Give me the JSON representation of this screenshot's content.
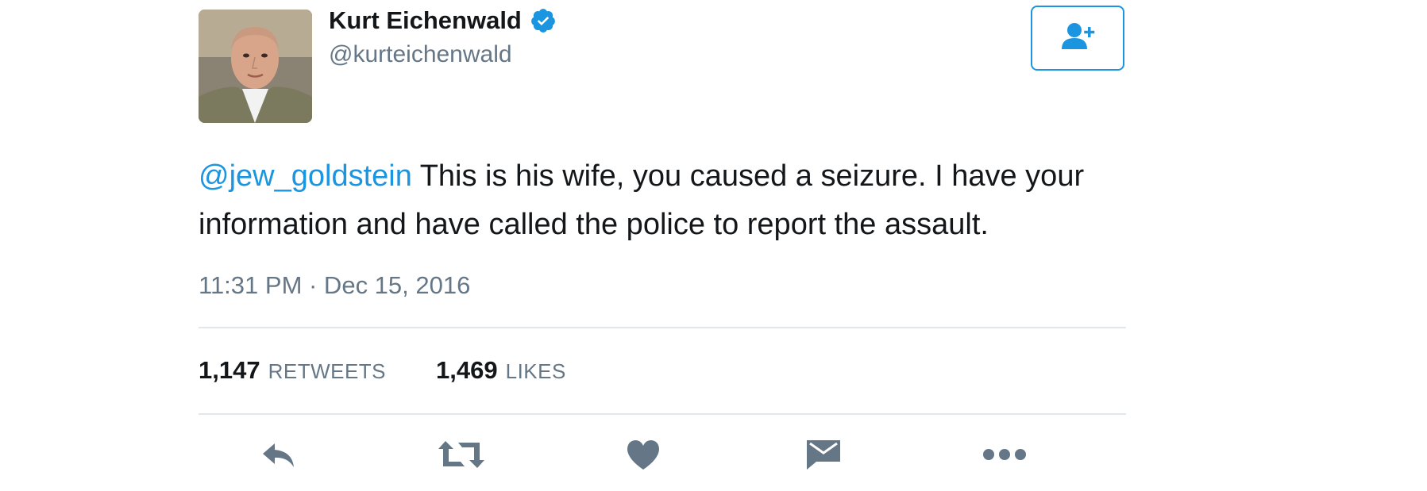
{
  "author": {
    "display_name": "Kurt Eichenwald",
    "handle": "@kurteichenwald",
    "verified": true
  },
  "follow_button": {
    "icon": "follow-user-icon"
  },
  "tweet": {
    "mention": "@jew_goldstein",
    "text": " This is his wife, you caused a seizure. I have your information and have called the police to report the assault.",
    "timestamp": "11:31 PM · Dec 15, 2016"
  },
  "stats": {
    "retweets_count": "1,147",
    "retweets_label": "RETWEETS",
    "likes_count": "1,469",
    "likes_label": "LIKES"
  },
  "actions": [
    {
      "icon": "reply-icon"
    },
    {
      "icon": "retweet-icon"
    },
    {
      "icon": "like-heart-icon"
    },
    {
      "icon": "direct-message-icon"
    },
    {
      "icon": "more-icon"
    }
  ],
  "colors": {
    "accent": "#1b95e0",
    "text": "#14171a",
    "secondary_text": "#657786",
    "action_icon": "#657786",
    "divider": "#e1e8ed"
  }
}
